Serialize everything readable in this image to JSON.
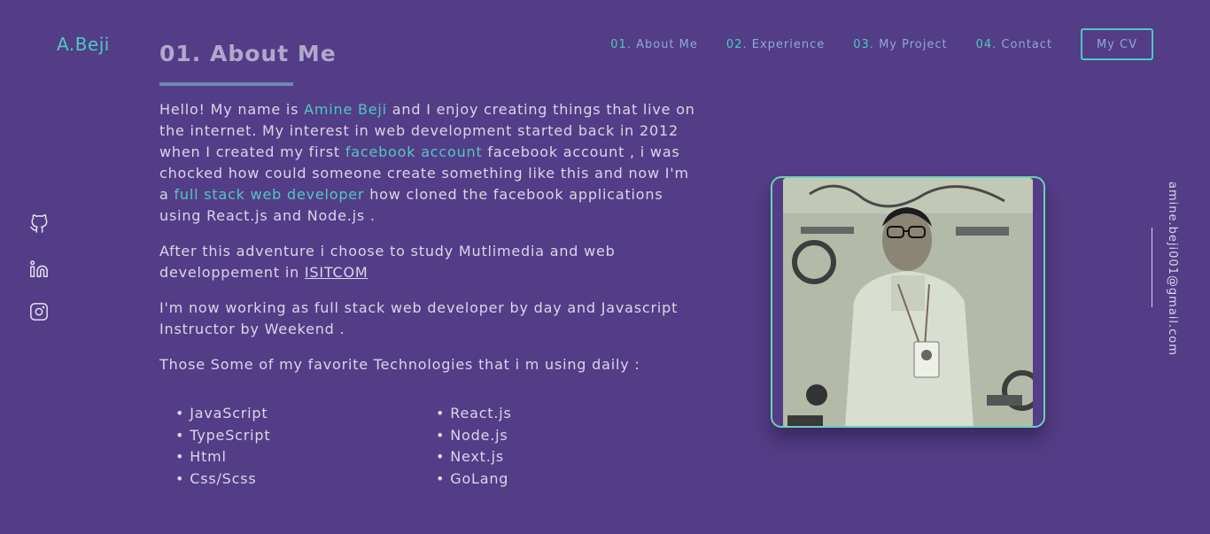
{
  "logo": "A.Beji",
  "nav": {
    "items": [
      {
        "num": "01.",
        "label": "About Me"
      },
      {
        "num": "02.",
        "label": "Experience"
      },
      {
        "num": "03.",
        "label": "My Project"
      },
      {
        "num": "04.",
        "label": "Contact"
      }
    ],
    "cv_label": "My CV"
  },
  "about": {
    "title": "01. About Me",
    "p1": {
      "t1": "Hello! My name is ",
      "name": "Amine Beji",
      "t2": " and I enjoy creating things that live on the internet. My interest in web development started back in 2012 when I created my first ",
      "link1": "facebook account",
      "t3": " facebook account , i was chocked how could someone create something like this and now I'm a ",
      "link2": "full stack web developer",
      "t4": " how cloned the facebook applications using React.js and Node.js ."
    },
    "p2": {
      "t1": "After this adventure i choose to study Mutlimedia and web developpement in ",
      "school": "ISITCOM"
    },
    "p3": "I'm now working as full stack web developer by day and Javascript Instructor by Weekend .",
    "p4": "Those Some of my favorite Technologies that i m using daily :",
    "technologies": [
      "JavaScript",
      "React.js",
      "TypeScript",
      "Node.js",
      "Html",
      "Next.js",
      "Css/Scss",
      "GoLang"
    ]
  },
  "social": {
    "icons": [
      "github-icon",
      "linkedin-icon",
      "instagram-icon"
    ]
  },
  "email": "amine.beji001@gmail.com",
  "colors": {
    "background": "#533d86",
    "accent": "#4fc7c4",
    "nav_text": "#8fa8d6",
    "body_text": "#d9d5ea"
  }
}
